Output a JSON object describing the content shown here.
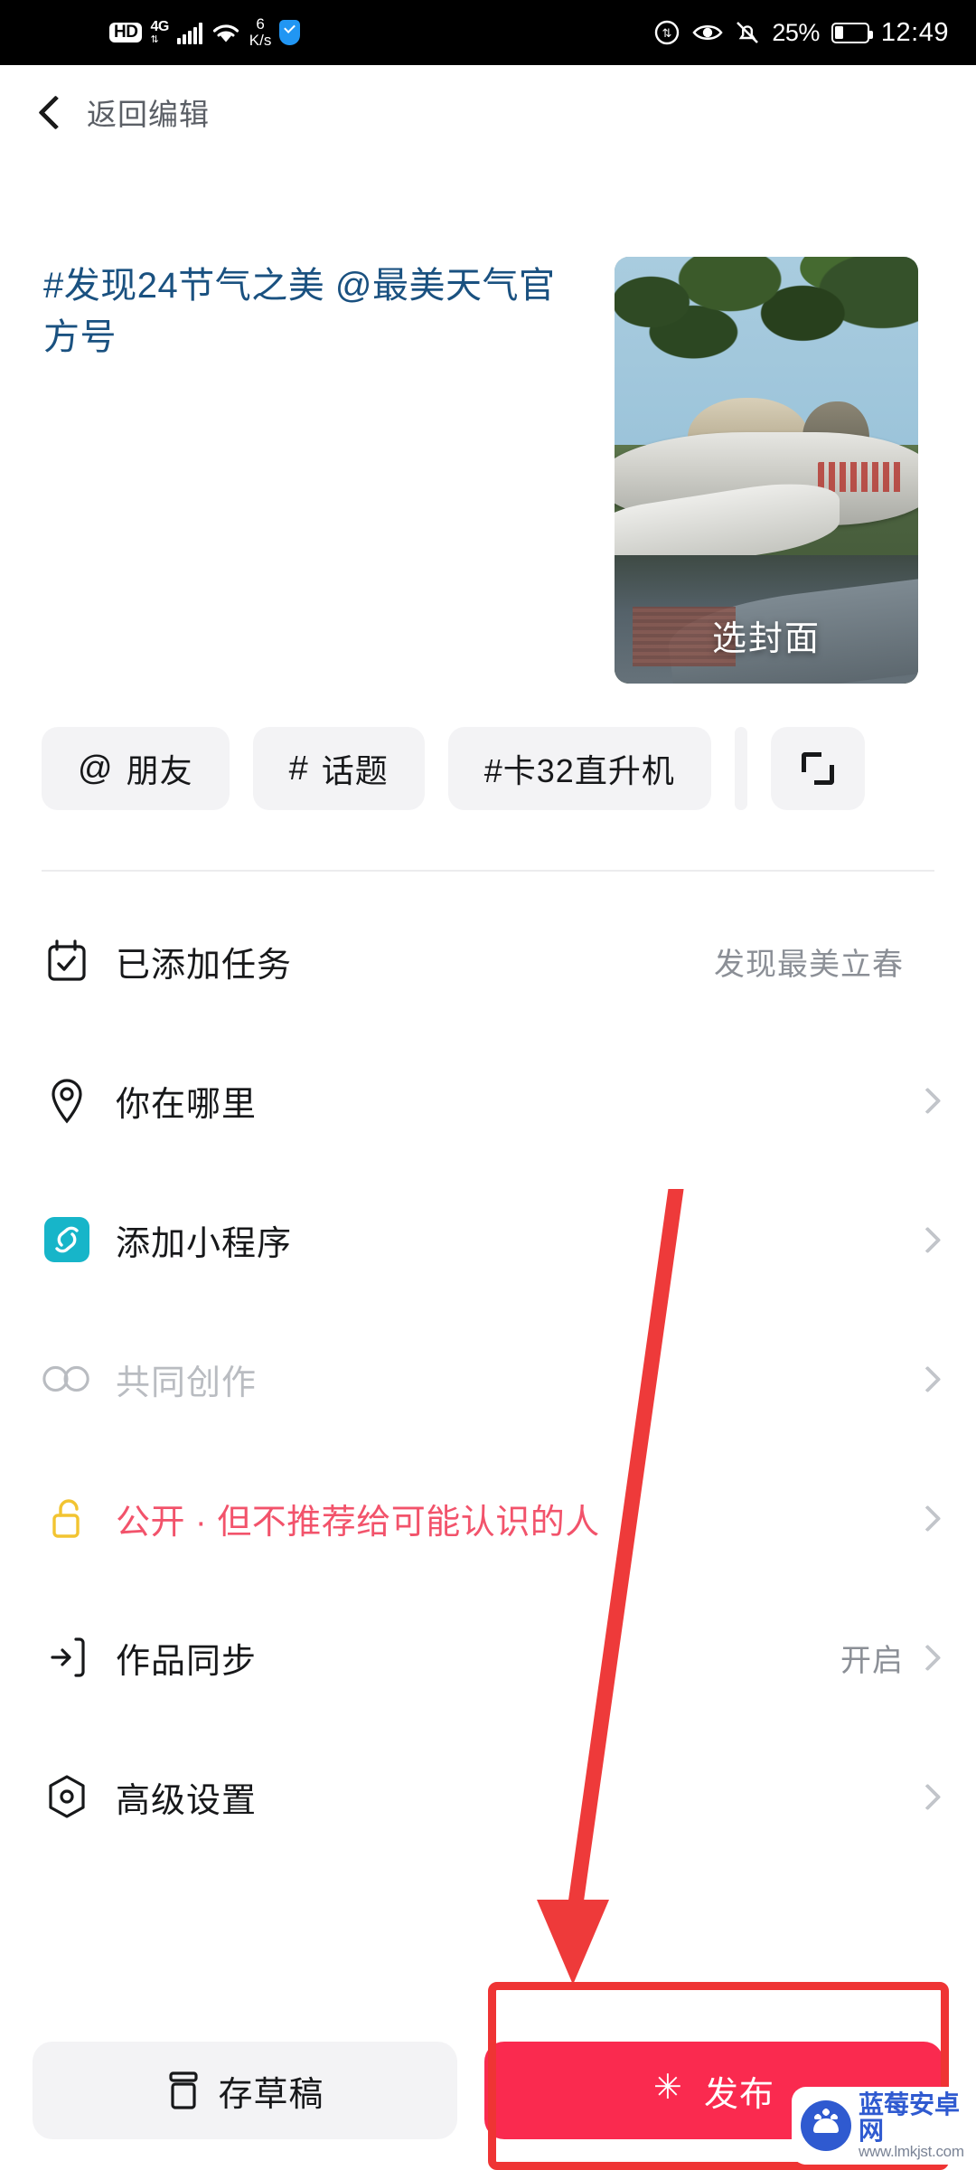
{
  "status_bar": {
    "hd": "HD",
    "network": "4G",
    "net_speed_value": "6",
    "net_speed_unit": "K/s",
    "battery_percent": "25%",
    "time": "12:49",
    "icons": [
      "hd-badge-icon",
      "signal-bars-icon",
      "wifi-icon",
      "net-speed-icon",
      "security-shield-icon",
      "data-transfer-icon",
      "eye-comfort-icon",
      "mute-bell-icon",
      "battery-icon"
    ]
  },
  "header": {
    "back_label": "返回编辑"
  },
  "compose": {
    "caption": "#发现24节气之美 @最美天气官方号",
    "caption_color": "#1a5180",
    "cover_label": "选封面"
  },
  "chips": [
    {
      "symbol": "@",
      "label": "朋友",
      "name": "mention-friend-chip"
    },
    {
      "symbol": "#",
      "label": "话题",
      "name": "topic-chip"
    },
    {
      "symbol": "",
      "label": "#卡32直升机",
      "name": "hashtag-ka32-chip"
    },
    {
      "symbol": "",
      "label": "",
      "name": "scan-chip"
    }
  ],
  "rows": [
    {
      "label": "已添加任务",
      "value": "发现最美立春",
      "icon": "task-calendar-icon",
      "state": "normal",
      "chevron": false
    },
    {
      "label": "你在哪里",
      "value": "",
      "icon": "location-pin-icon",
      "state": "normal",
      "chevron": true
    },
    {
      "label": "添加小程序",
      "value": "",
      "icon": "mini-program-icon",
      "state": "normal",
      "chevron": true
    },
    {
      "label": "共同创作",
      "value": "",
      "icon": "co-creation-icon",
      "state": "disabled",
      "chevron": true
    },
    {
      "label": "公开 · 但不推荐给可能认识的人",
      "value": "",
      "icon": "unlock-icon",
      "state": "warn",
      "chevron": true
    },
    {
      "label": "作品同步",
      "value": "开启",
      "icon": "sync-icon",
      "state": "normal",
      "chevron": true
    },
    {
      "label": "高级设置",
      "value": "",
      "icon": "advanced-settings-icon",
      "state": "normal",
      "chevron": true
    }
  ],
  "bottom_bar": {
    "draft_label": "存草稿",
    "publish_label": "发布",
    "publish_color": "#fa2a4f"
  },
  "annotation": {
    "highlight_color": "#ef3434"
  },
  "watermark": {
    "site_name": "蓝莓安卓网",
    "url": "www.lmkjst.com"
  }
}
